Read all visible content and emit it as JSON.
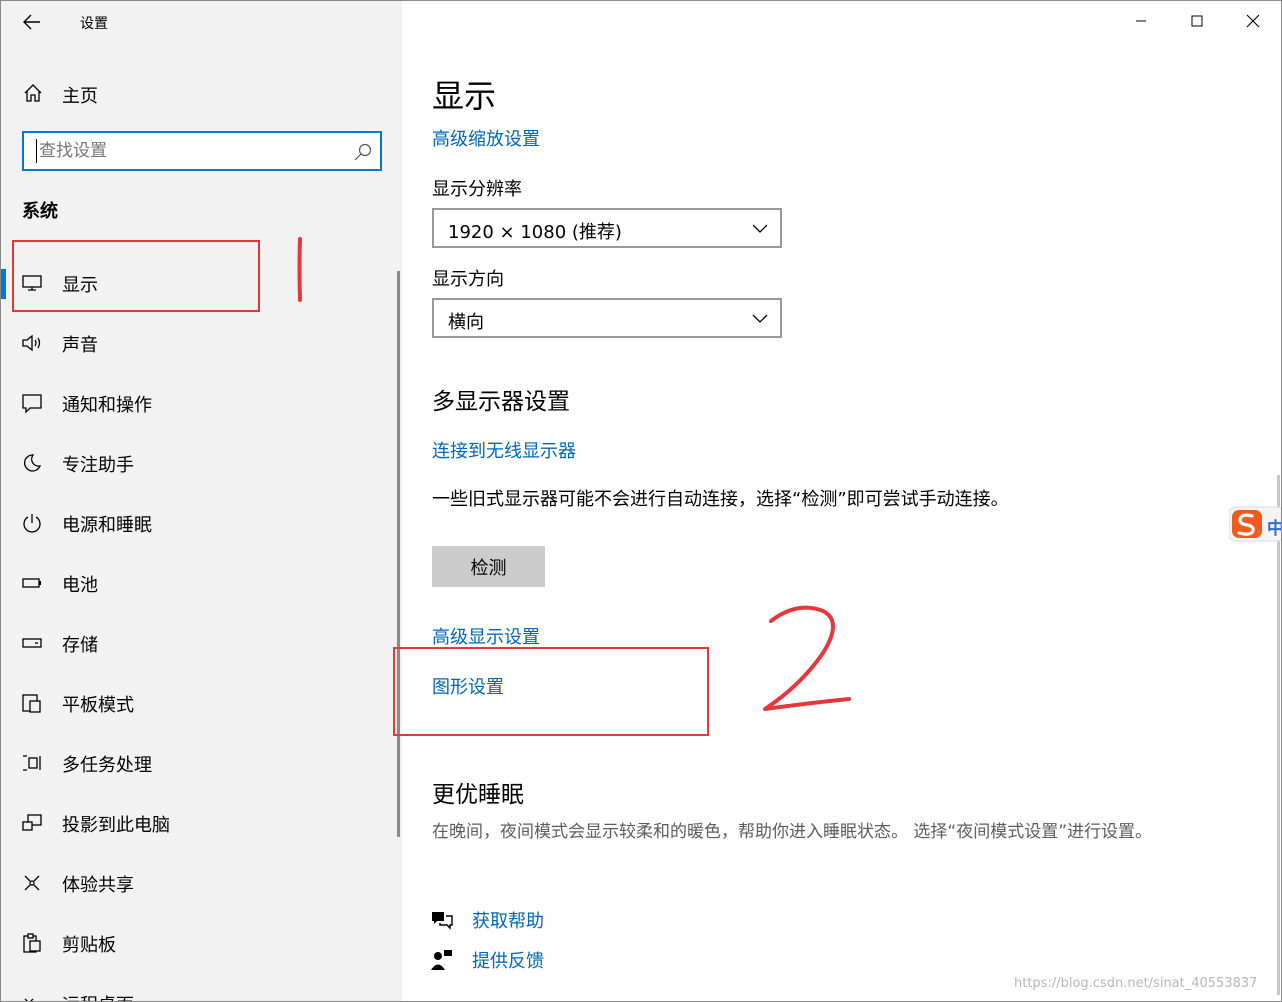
{
  "window": {
    "title": "设置"
  },
  "sidebar": {
    "home_label": "主页",
    "search_placeholder": "查找设置",
    "section_title": "系统",
    "items": [
      {
        "label": "显示",
        "icon": "monitor-icon",
        "active": true
      },
      {
        "label": "声音",
        "icon": "speaker-icon"
      },
      {
        "label": "通知和操作",
        "icon": "notification-icon"
      },
      {
        "label": "专注助手",
        "icon": "moon-icon"
      },
      {
        "label": "电源和睡眠",
        "icon": "power-icon"
      },
      {
        "label": "电池",
        "icon": "battery-icon"
      },
      {
        "label": "存储",
        "icon": "storage-icon"
      },
      {
        "label": "平板模式",
        "icon": "tablet-icon"
      },
      {
        "label": "多任务处理",
        "icon": "multitask-icon"
      },
      {
        "label": "投影到此电脑",
        "icon": "project-icon"
      },
      {
        "label": "体验共享",
        "icon": "share-icon"
      },
      {
        "label": "剪贴板",
        "icon": "clipboard-icon"
      },
      {
        "label": "远程桌面",
        "icon": "remote-desktop-icon"
      }
    ]
  },
  "main": {
    "title": "显示",
    "advanced_scaling_link": "高级缩放设置",
    "resolution_label": "显示分辨率",
    "resolution_value": "1920 × 1080 (推荐)",
    "orientation_label": "显示方向",
    "orientation_value": "横向",
    "multi_display_title": "多显示器设置",
    "wireless_link": "连接到无线显示器",
    "detect_description": "一些旧式显示器可能不会进行自动连接，选择“检测”即可尝试手动连接。",
    "detect_button": "检测",
    "advanced_display_link": "高级显示设置",
    "graphics_link": "图形设置",
    "sleep_title": "更优睡眠",
    "sleep_description": "在晚间，夜间模式会显示较柔和的暖色，帮助你进入睡眠状态。 选择“夜间模式设置”进行设置。",
    "help_link": "获取帮助",
    "feedback_link": "提供反馈"
  },
  "annotations": {
    "mark_1": "1",
    "mark_2": "2",
    "color": "#e8373b"
  },
  "ime_badge": {
    "text": "中"
  },
  "watermark": "https://blog.csdn.net/sinat_40553837",
  "colors": {
    "accent": "#0078d7",
    "link": "#0067b8",
    "sidebar_bg": "#f2f2f2"
  }
}
